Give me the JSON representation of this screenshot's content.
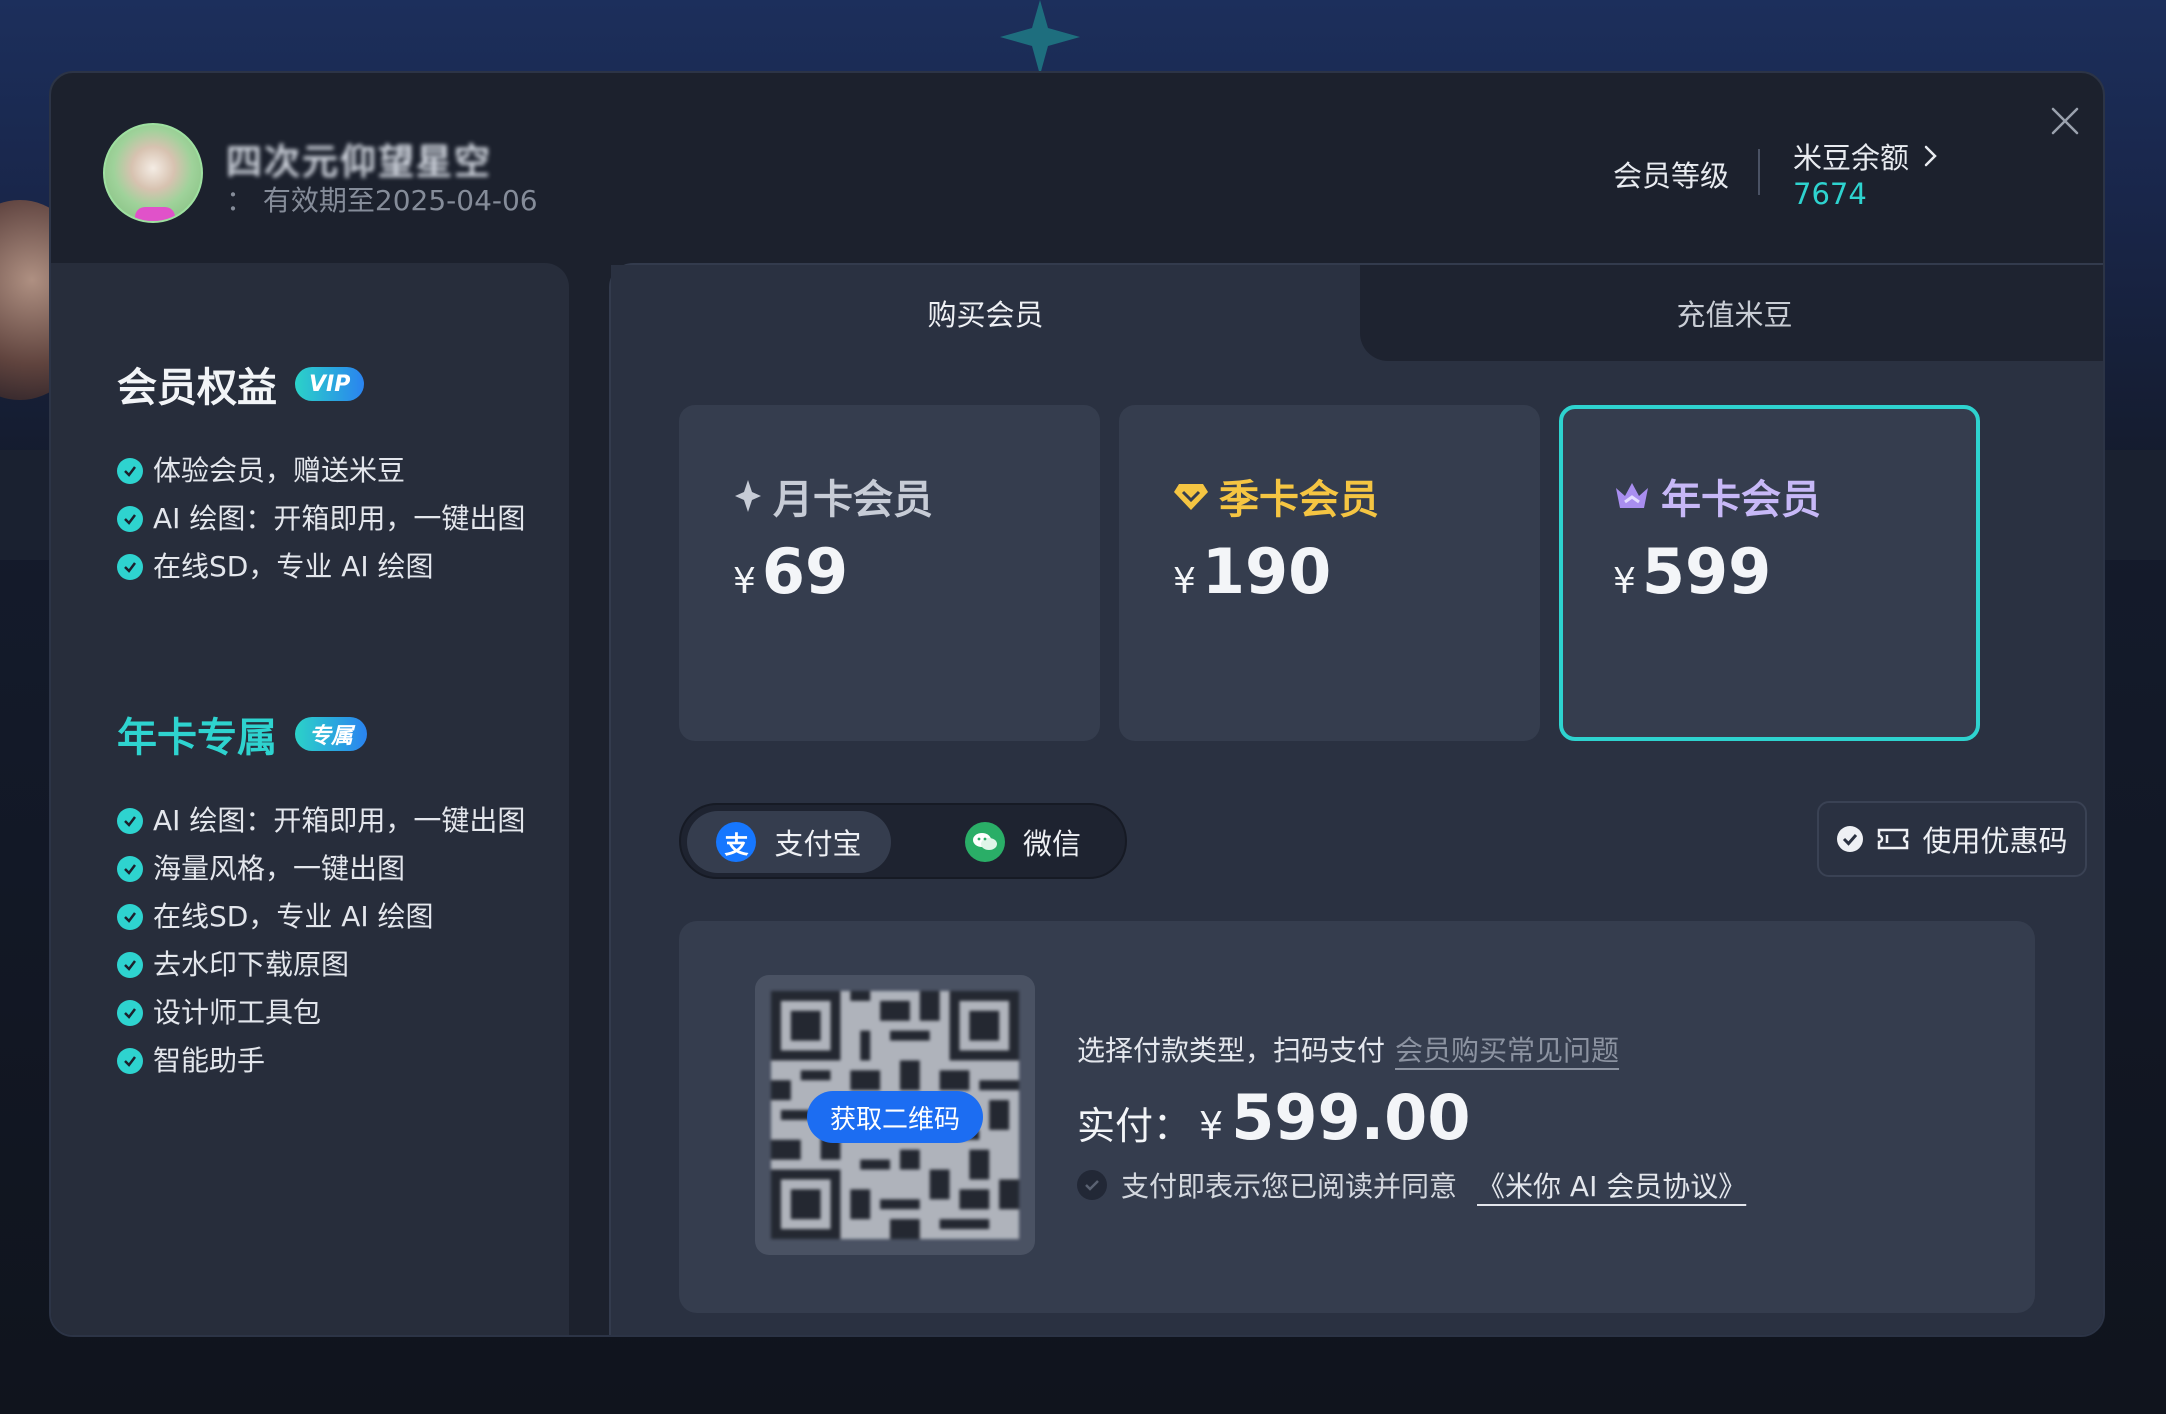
{
  "header": {
    "username": "四次元仰望星空",
    "validity": "： 有效期至2025-04-06",
    "level_label": "会员等级",
    "balance_label": "米豆余额",
    "balance_value": "7674"
  },
  "benefits": {
    "vip_title": "会员权益",
    "vip_badge": "VIP",
    "vip_items": [
      "体验会员，赠送米豆",
      "AI 绘图：开箱即用，一键出图",
      "在线SD，专业 AI 绘图"
    ],
    "annual_title": "年卡专属",
    "annual_badge": "专属",
    "annual_items": [
      "AI 绘图：开箱即用，一键出图",
      "海量风格，一键出图",
      "在线SD，专业 AI 绘图",
      "去水印下载原图",
      "设计师工具包",
      "智能助手"
    ]
  },
  "tabs": [
    {
      "label": "购买会员",
      "active": true
    },
    {
      "label": "充值米豆",
      "active": false
    }
  ],
  "plans": [
    {
      "name": "月卡会员",
      "currency": "¥",
      "price": "69",
      "color": "#c7ccd6",
      "icon": "sparkle-icon"
    },
    {
      "name": "季卡会员",
      "currency": "¥",
      "price": "190",
      "color": "#f5c542",
      "icon": "diamond-icon"
    },
    {
      "name": "年卡会员",
      "currency": "¥",
      "price": "599",
      "color": "#c7b8f7",
      "icon": "crown-icon",
      "selected": true
    }
  ],
  "payment": {
    "alipay_label": "支付宝",
    "wechat_label": "微信",
    "alipay_glyph": "支",
    "coupon_label": "使用优惠码",
    "qr_button": "获取二维码",
    "instruction": "选择付款类型，扫码支付",
    "faq_link": "会员购买常见问题",
    "amount_label": "实付：",
    "amount_currency": "¥",
    "amount_value": "599.00",
    "agree_text": "支付即表示您已阅读并同意",
    "agreement_link": "《米你 AI 会员协议》"
  },
  "colors": {
    "accent": "#2ed3cf",
    "qr_button": "#1c6df2",
    "alipay": "#1677ff",
    "wechat": "#2aae67"
  }
}
